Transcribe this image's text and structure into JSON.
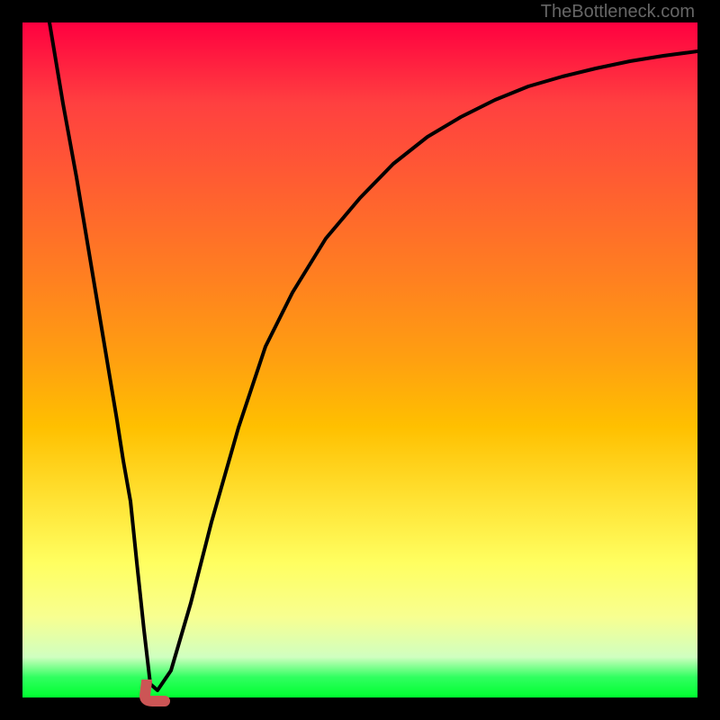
{
  "watermark": "TheBottleneck.com",
  "chart_data": {
    "type": "line",
    "title": "",
    "xlabel": "",
    "ylabel": "",
    "xlim": [
      0,
      100
    ],
    "ylim": [
      0,
      100
    ],
    "series": [
      {
        "name": "bottleneck-curve",
        "x": [
          4,
          6,
          8,
          10,
          12,
          14,
          15,
          16,
          17,
          18,
          19,
          20,
          22,
          25,
          28,
          32,
          36,
          40,
          45,
          50,
          55,
          60,
          65,
          70,
          75,
          80,
          85,
          90,
          95,
          100
        ],
        "values": [
          100,
          88,
          77,
          65,
          53,
          41,
          35,
          29,
          20,
          10,
          2,
          1,
          4,
          14,
          26,
          40,
          52,
          60,
          68,
          74,
          79,
          83,
          86,
          88.5,
          90.5,
          92,
          93.2,
          94.2,
          95,
          95.7
        ]
      }
    ],
    "marker": {
      "name": "optimal-point",
      "x": 19.5,
      "y": 2,
      "color": "#cc5555"
    },
    "gradient_description": "Red (top/high bottleneck) to Green (bottom/low bottleneck)"
  }
}
